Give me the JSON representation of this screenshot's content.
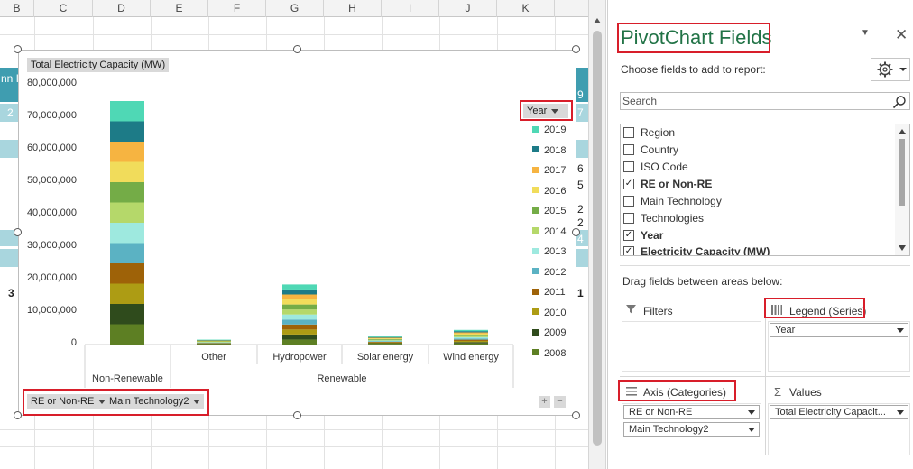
{
  "sheet": {
    "columns": [
      "B",
      "C",
      "D",
      "E",
      "F",
      "G",
      "H",
      "I",
      "J",
      "K"
    ],
    "left_fragments": [
      "nn I",
      "2",
      "3"
    ],
    "right_fragments": [
      "9",
      "7",
      "6",
      "5",
      "2",
      "2",
      "4",
      "1"
    ]
  },
  "chart": {
    "value_field_button": "Total Electricity Capacity (MW)",
    "legend_field_button": "Year",
    "axis_field_buttons": [
      "RE or Non-RE",
      "Main Technology2"
    ],
    "plus_label": "+",
    "minus_label": "−"
  },
  "chart_data": {
    "type": "bar",
    "stacked": true,
    "ylim": [
      0,
      80000000
    ],
    "yticks": [
      "0",
      "10,000,000",
      "20,000,000",
      "30,000,000",
      "40,000,000",
      "50,000,000",
      "60,000,000",
      "70,000,000",
      "80,000,000"
    ],
    "categories": [
      "Non-Renewable",
      "Other",
      "Hydropower",
      "Solar energy",
      "Wind energy"
    ],
    "groups": [
      {
        "label": "Non-Renewable",
        "categories": [
          "Non-Renewable"
        ]
      },
      {
        "label": "Renewable",
        "categories": [
          "Other",
          "Hydropower",
          "Solar energy",
          "Wind energy"
        ]
      }
    ],
    "totals": [
      75000000,
      1500000,
      18500000,
      2500000,
      4500000
    ],
    "legend_title": "Year",
    "legend": [
      "2019",
      "2018",
      "2017",
      "2016",
      "2015",
      "2014",
      "2013",
      "2012",
      "2011",
      "2010",
      "2009",
      "2008"
    ],
    "series_colors": [
      "#4fd8b5",
      "#1d7b87",
      "#f6b441",
      "#f1dc5b",
      "#74ac47",
      "#b5d86a",
      "#9ee9df",
      "#5bb2c3",
      "#9e6208",
      "#ad9c14",
      "#2f4b1c",
      "#5d7f23"
    ]
  },
  "pane": {
    "title": "PivotChart Fields",
    "choose_label": "Choose fields to add to report:",
    "search_placeholder": "Search",
    "fields": [
      {
        "label": "Region",
        "checked": false,
        "bold": false
      },
      {
        "label": "Country",
        "checked": false,
        "bold": false
      },
      {
        "label": "ISO Code",
        "checked": false,
        "bold": false
      },
      {
        "label": "RE or Non-RE",
        "checked": true,
        "bold": true
      },
      {
        "label": "Main Technology",
        "checked": false,
        "bold": false
      },
      {
        "label": "Technologies",
        "checked": false,
        "bold": false
      },
      {
        "label": "Year",
        "checked": true,
        "bold": true
      },
      {
        "label": "Electricity Capacity (MW)",
        "checked": true,
        "bold": true
      }
    ],
    "drag_label": "Drag fields between areas below:",
    "areas": {
      "filters": {
        "title": "Filters",
        "items": []
      },
      "legend": {
        "title": "Legend (Series)",
        "items": [
          "Year"
        ]
      },
      "axis": {
        "title": "Axis (Categories)",
        "items": [
          "RE or Non-RE",
          "Main Technology2"
        ]
      },
      "values": {
        "title": "Values",
        "items": [
          "Total Electricity Capacit..."
        ]
      }
    }
  }
}
